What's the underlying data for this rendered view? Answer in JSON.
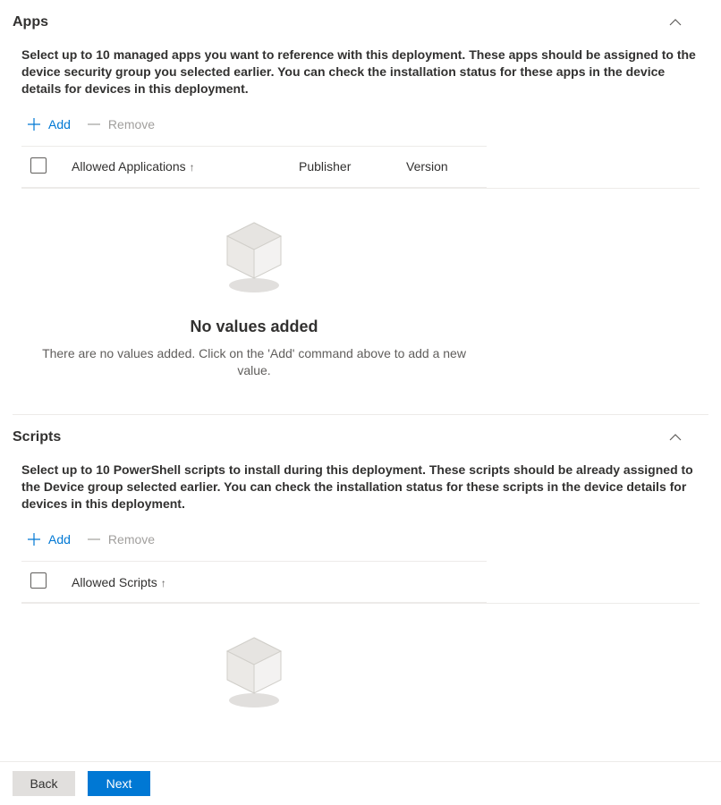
{
  "apps": {
    "title": "Apps",
    "description": "Select up to 10 managed apps you want to reference with this deployment. These apps should be assigned to the device security group you selected earlier. You can check the installation status for these apps in the device details for devices in this deployment.",
    "add_label": "Add",
    "remove_label": "Remove",
    "columns": {
      "allowed": "Allowed Applications",
      "publisher": "Publisher",
      "version": "Version"
    },
    "empty_title": "No values added",
    "empty_subtitle": "There are no values added. Click on the 'Add' command above to add a new value."
  },
  "scripts": {
    "title": "Scripts",
    "description": "Select up to 10 PowerShell scripts to install during this deployment. These scripts should be already assigned to the Device group selected earlier. You can check the installation status for these scripts in the device details for devices in this deployment.",
    "add_label": "Add",
    "remove_label": "Remove",
    "columns": {
      "allowed": "Allowed Scripts"
    }
  },
  "footer": {
    "back": "Back",
    "next": "Next"
  }
}
